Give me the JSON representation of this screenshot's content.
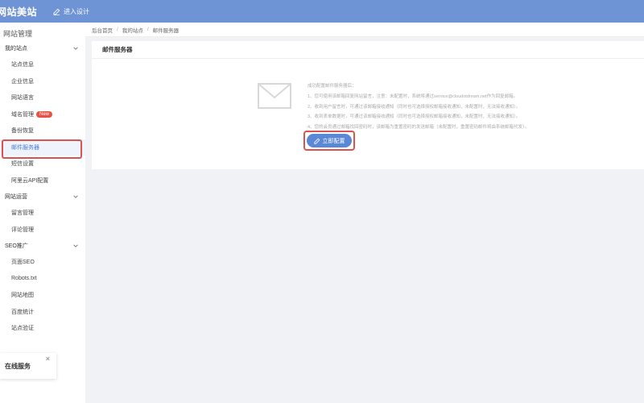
{
  "topbar": {
    "logo": "网站美站",
    "enter_design": "进入设计"
  },
  "sidebar": {
    "title": "网站管理",
    "groups": [
      {
        "label": "我的站点",
        "items": [
          "站点信息",
          "企业信息",
          "网站语言",
          "域名管理",
          "备份恢复",
          "邮件服务器",
          "短信设置",
          "阿里云API配置"
        ]
      },
      {
        "label": "网站运营",
        "items": [
          "留言管理",
          "评论管理"
        ]
      },
      {
        "label": "SEO推广",
        "items": [
          "页面SEO",
          "Robots.txt",
          "网站地图",
          "百度统计",
          "站点验证"
        ]
      }
    ],
    "new_badge": "New"
  },
  "online_service": {
    "label": "在线服务",
    "close": "×"
  },
  "breadcrumb": [
    "后台首页",
    "我的站点",
    "邮件服务器"
  ],
  "card": {
    "title": "邮件服务器",
    "info_lines": [
      "成功配置邮件服务器后：",
      "1、您可使用该邮箱回复网站留言，注意：未配置时，系统将通过service@cloudotdream.net作为回复邮箱。",
      "2、收到用户留言时，可通过该邮箱接收通知（同时也可选择授权邮箱接收通知，未配置时，无法接收通知）。",
      "3、收到表单数据时，可通过该邮箱接收通知（同时也可选择授权邮箱接收通知，未配置时，无法接收通知）。",
      "4、您的会员通过邮箱找回密码时，该邮箱为重置密码的发送邮箱（未配置时，重置密码邮件将由系统邮箱代发）。"
    ],
    "config_button": "立即配置"
  }
}
